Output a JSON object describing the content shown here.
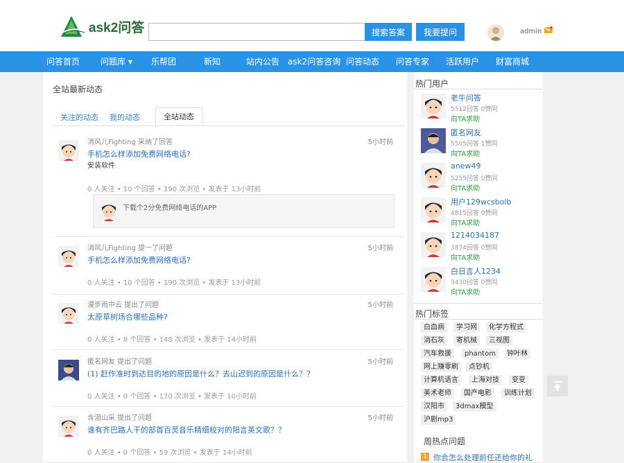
{
  "logo": {
    "text": "ask2问答"
  },
  "search": {
    "value": "",
    "placeholder": "",
    "search_btn": "搜索答案",
    "ask_btn": "我要提问"
  },
  "user": {
    "name": "admin"
  },
  "nav": [
    "问答首页",
    "问题库 ▾",
    "乐帮团",
    "新知",
    "站内公告",
    "ask2问答咨询",
    "问答动态",
    "问答专家",
    "活跃用户",
    "财富商城"
  ],
  "main": {
    "title": "全站最新动态",
    "tabs": [
      "关注的动态",
      "我的动态",
      "全站动态"
    ],
    "feed": [
      {
        "meta": "消风儿Fighting 采纳了回答",
        "time": "5小时前",
        "title": "手机怎么样添加免费网络电话?",
        "sub": "安装软件",
        "stats": "0 人关注 • 10 个回答 • 190 次浏览 • 发表于 13小时前",
        "quote": "下载个2分免费网络电话的APP"
      },
      {
        "meta": "消风儿Fighting 提一了问题",
        "time": "5小时前",
        "title": "手机怎么样添加免费网络电话?",
        "stats": "0 人关注 • 10 个回答 • 190 次浏览 • 发表于 13小时前"
      },
      {
        "meta": "漫步雨中云 提出了问题",
        "time": "5小时前",
        "title": "太原草树场合哪些品种?",
        "stats": "0 人关注 • 0 个回答 • 148 次浏览 • 发表于 14小时前"
      },
      {
        "meta": "匿名网友 提出了问题",
        "time": "5小时前",
        "title": "(1) 赶作准时到达目的地的原因是什么？去山迟到的原因是什么？？",
        "stats": "0 人关注 • 0 个回答 • 170 次浏览 • 发表于 10小时前"
      },
      {
        "meta": "含泪山采 提出了问题",
        "time": "5小时前",
        "title": "谁有齐巴路人干的部首百灵音乐精细校对的阳言英文歌？？",
        "stats": "0 人关注 • 0 个回答 • 59 次浏览 • 发表于 14小时前"
      }
    ]
  },
  "sidebar": {
    "hot_users_title": "热门用户",
    "hot_users": [
      {
        "name": "老牛问答",
        "stats": "5512回答    0赞同",
        "ask": "向TA求助"
      },
      {
        "name": "匿名网友",
        "stats": "5505回答    1赞同",
        "ask": "向TA求助"
      },
      {
        "name": "anew49",
        "stats": "5255回答    0赞同",
        "ask": "向TA求助"
      },
      {
        "name": "用户129wcsbolb",
        "stats": "4815回答    0赞同",
        "ask": "向TA求助"
      },
      {
        "name": "1214034187",
        "stats": "3874回答    0赞同",
        "ask": "向TA求助"
      },
      {
        "name": "白日言人1234",
        "stats": "3430回答    0赞同",
        "ask": "向TA求助"
      }
    ],
    "hot_tags_title": "热门标签",
    "tags": [
      "白血病",
      "学习网",
      "化学方程式",
      "消石灰",
      "寄机械",
      "三视图",
      "汽车救援",
      "phantom",
      "钟叶林",
      "网上赚零刷",
      "点钞机",
      "计算机语言",
      "上海对技",
      "变变",
      "美术老师",
      "国产电影",
      "训练计划",
      "汉阳市",
      "3dmax模型",
      "沪剧mp3"
    ],
    "weekly_title": "周热点问题",
    "weekly_item": "你会怎么处理前任还给你的礼"
  },
  "colors": {
    "nav": "#2b93e5",
    "button": "#2b91e3",
    "link": "#2b6fb6",
    "green": "#2e9c3e"
  }
}
